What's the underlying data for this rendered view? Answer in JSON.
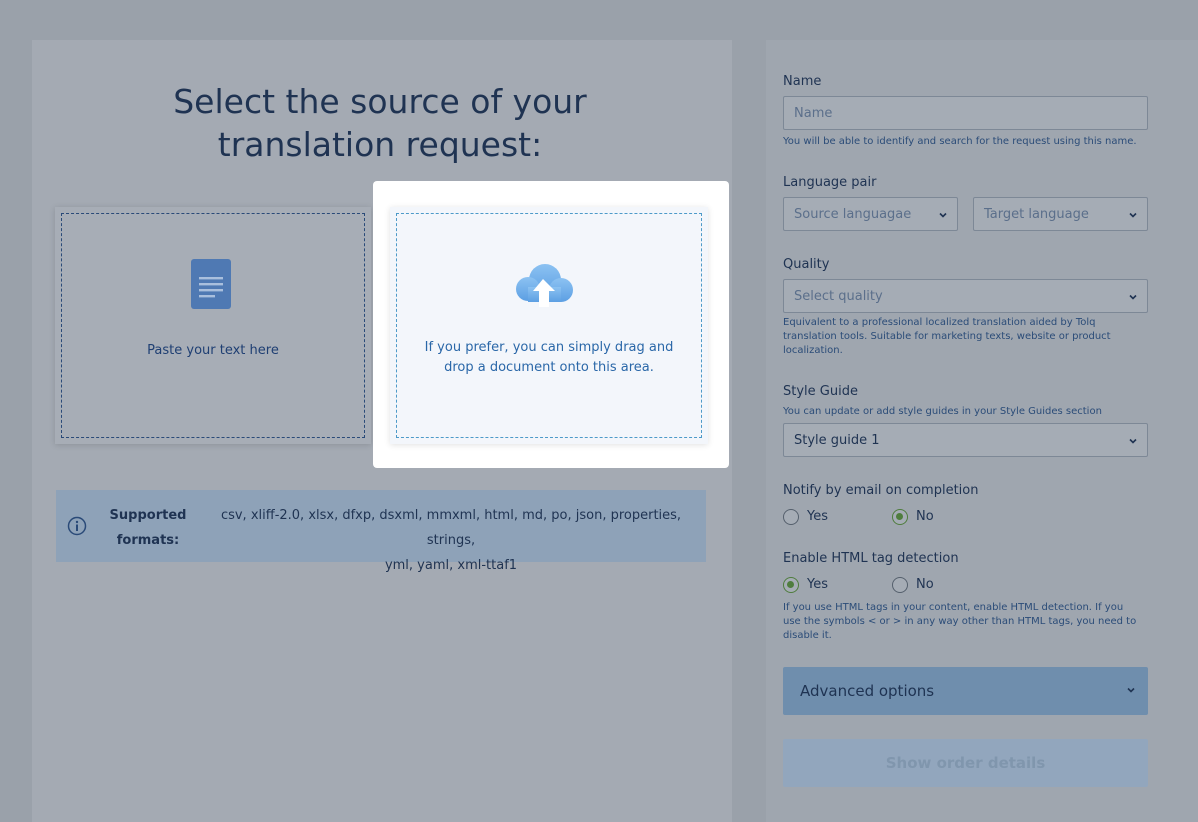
{
  "main": {
    "title_line1": "Select the source of your",
    "title_line2": "translation request:",
    "paste_label": "Paste your text here",
    "drop_line1": "If you prefer, you can simply drag and",
    "drop_line2": "drop a document onto this area.",
    "formats_label_line1": "Supported",
    "formats_label_line2": "formats:",
    "formats_line1": "csv, xliff-2.0, xlsx, dfxp, dsxml, mmxml, html, md, po, json, properties, strings,",
    "formats_line2": "yml, yaml, xml-ttaf1"
  },
  "form": {
    "name_label": "Name",
    "name_placeholder": "Name",
    "name_help": "You will be able to identify and search for the request using this name.",
    "language_label": "Language pair",
    "source_placeholder": "Source languagae",
    "target_placeholder": "Target language",
    "quality_label": "Quality",
    "quality_placeholder": "Select quality",
    "quality_help_1": "Equivalent to a professional localized translation aided by Tolq",
    "quality_help_2": "translation tools. Suitable for marketing texts, website or product",
    "quality_help_3": "localization.",
    "style_label": "Style Guide",
    "style_help": "You can update or add style guides in your Style Guides section",
    "style_value": "Style guide 1",
    "notify_label": "Notify by email on completion",
    "notify_yes": "Yes",
    "notify_no": "No",
    "notify_selected": "No",
    "html_label": "Enable HTML tag detection",
    "html_yes": "Yes",
    "html_no": "No",
    "html_selected": "Yes",
    "html_help_1": "If you use HTML tags in your content, enable HTML detection. If you",
    "html_help_2": "use the symbols < or > in any way other than HTML tags, you need to",
    "html_help_3": "disable it.",
    "advanced_label": "Advanced options",
    "order_button": "Show order details"
  },
  "icons": {
    "document": "document-icon",
    "upload": "cloud-upload-icon",
    "info": "info-icon",
    "chevron": "chevron-down-icon"
  },
  "colors": {
    "title": "#1f3352",
    "accent": "#2a67a8",
    "radio_selected": "#4f7d3e"
  }
}
